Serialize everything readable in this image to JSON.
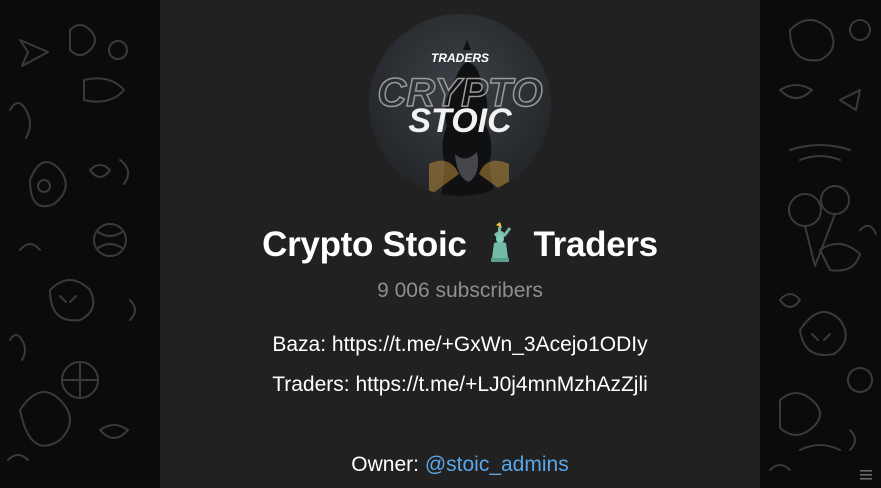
{
  "channel": {
    "avatar": {
      "badge_text": "TRADERS",
      "ghost_text": "CRYPTO",
      "main_text": "STOIC"
    },
    "title_part1": "Crypto Stoic",
    "title_emoji": "statue-of-liberty-icon",
    "title_part2": "Traders",
    "subscribers": "9 006 subscribers",
    "description": {
      "baza_label": "Baza: ",
      "baza_link": "https://t.me/+GxWn_3Acejo1ODIy",
      "traders_label": "Traders: ",
      "traders_link": "https://t.me/+LJ0j4mnMzhAzZjli",
      "owner_label": "Owner: ",
      "owner_handle": "@stoic_admins"
    }
  },
  "colors": {
    "background": "#0b0b0b",
    "card": "#212121",
    "link": "#5aa6e8",
    "muted": "#8e8e93"
  }
}
